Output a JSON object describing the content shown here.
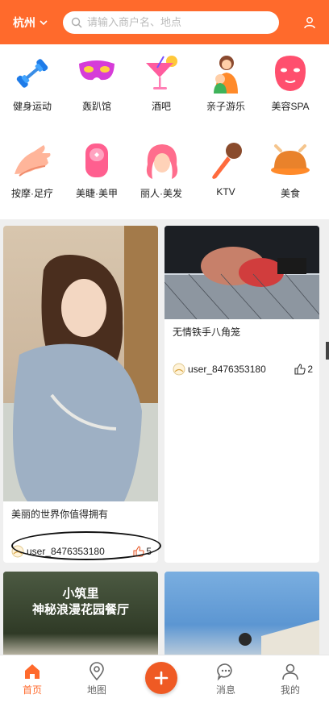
{
  "header": {
    "city": "杭州",
    "search_placeholder": "请输入商户名、地点"
  },
  "categories": [
    {
      "label": "健身运动",
      "icon": "dumbbell-icon"
    },
    {
      "label": "轰趴馆",
      "icon": "party-mask-icon"
    },
    {
      "label": "酒吧",
      "icon": "cocktail-icon"
    },
    {
      "label": "亲子游乐",
      "icon": "parent-child-icon"
    },
    {
      "label": "美容SPA",
      "icon": "face-mask-icon"
    },
    {
      "label": "按摩·足疗",
      "icon": "massage-hand-icon"
    },
    {
      "label": "美睫·美甲",
      "icon": "nail-icon"
    },
    {
      "label": "丽人·美发",
      "icon": "hair-icon"
    },
    {
      "label": "KTV",
      "icon": "microphone-icon"
    },
    {
      "label": "美食",
      "icon": "roast-chicken-icon"
    }
  ],
  "feed": [
    {
      "title": "美丽的世界你值得拥有",
      "user": "user_8476353180",
      "likes": "5"
    },
    {
      "title": "无情铁手八角笼",
      "user": "user_8476353180",
      "likes": "2"
    },
    {
      "overlay_line1": "小筑里",
      "overlay_line2": "神秘浪漫花园餐厅"
    }
  ],
  "tabbar": [
    {
      "label": "首页",
      "icon": "home-icon",
      "active": true
    },
    {
      "label": "地图",
      "icon": "map-pin-icon"
    },
    {
      "label": "",
      "icon": "plus-icon"
    },
    {
      "label": "消息",
      "icon": "message-icon"
    },
    {
      "label": "我的",
      "icon": "profile-icon"
    }
  ],
  "colors": {
    "accent": "#ff6a2c",
    "background": "#efefef"
  }
}
